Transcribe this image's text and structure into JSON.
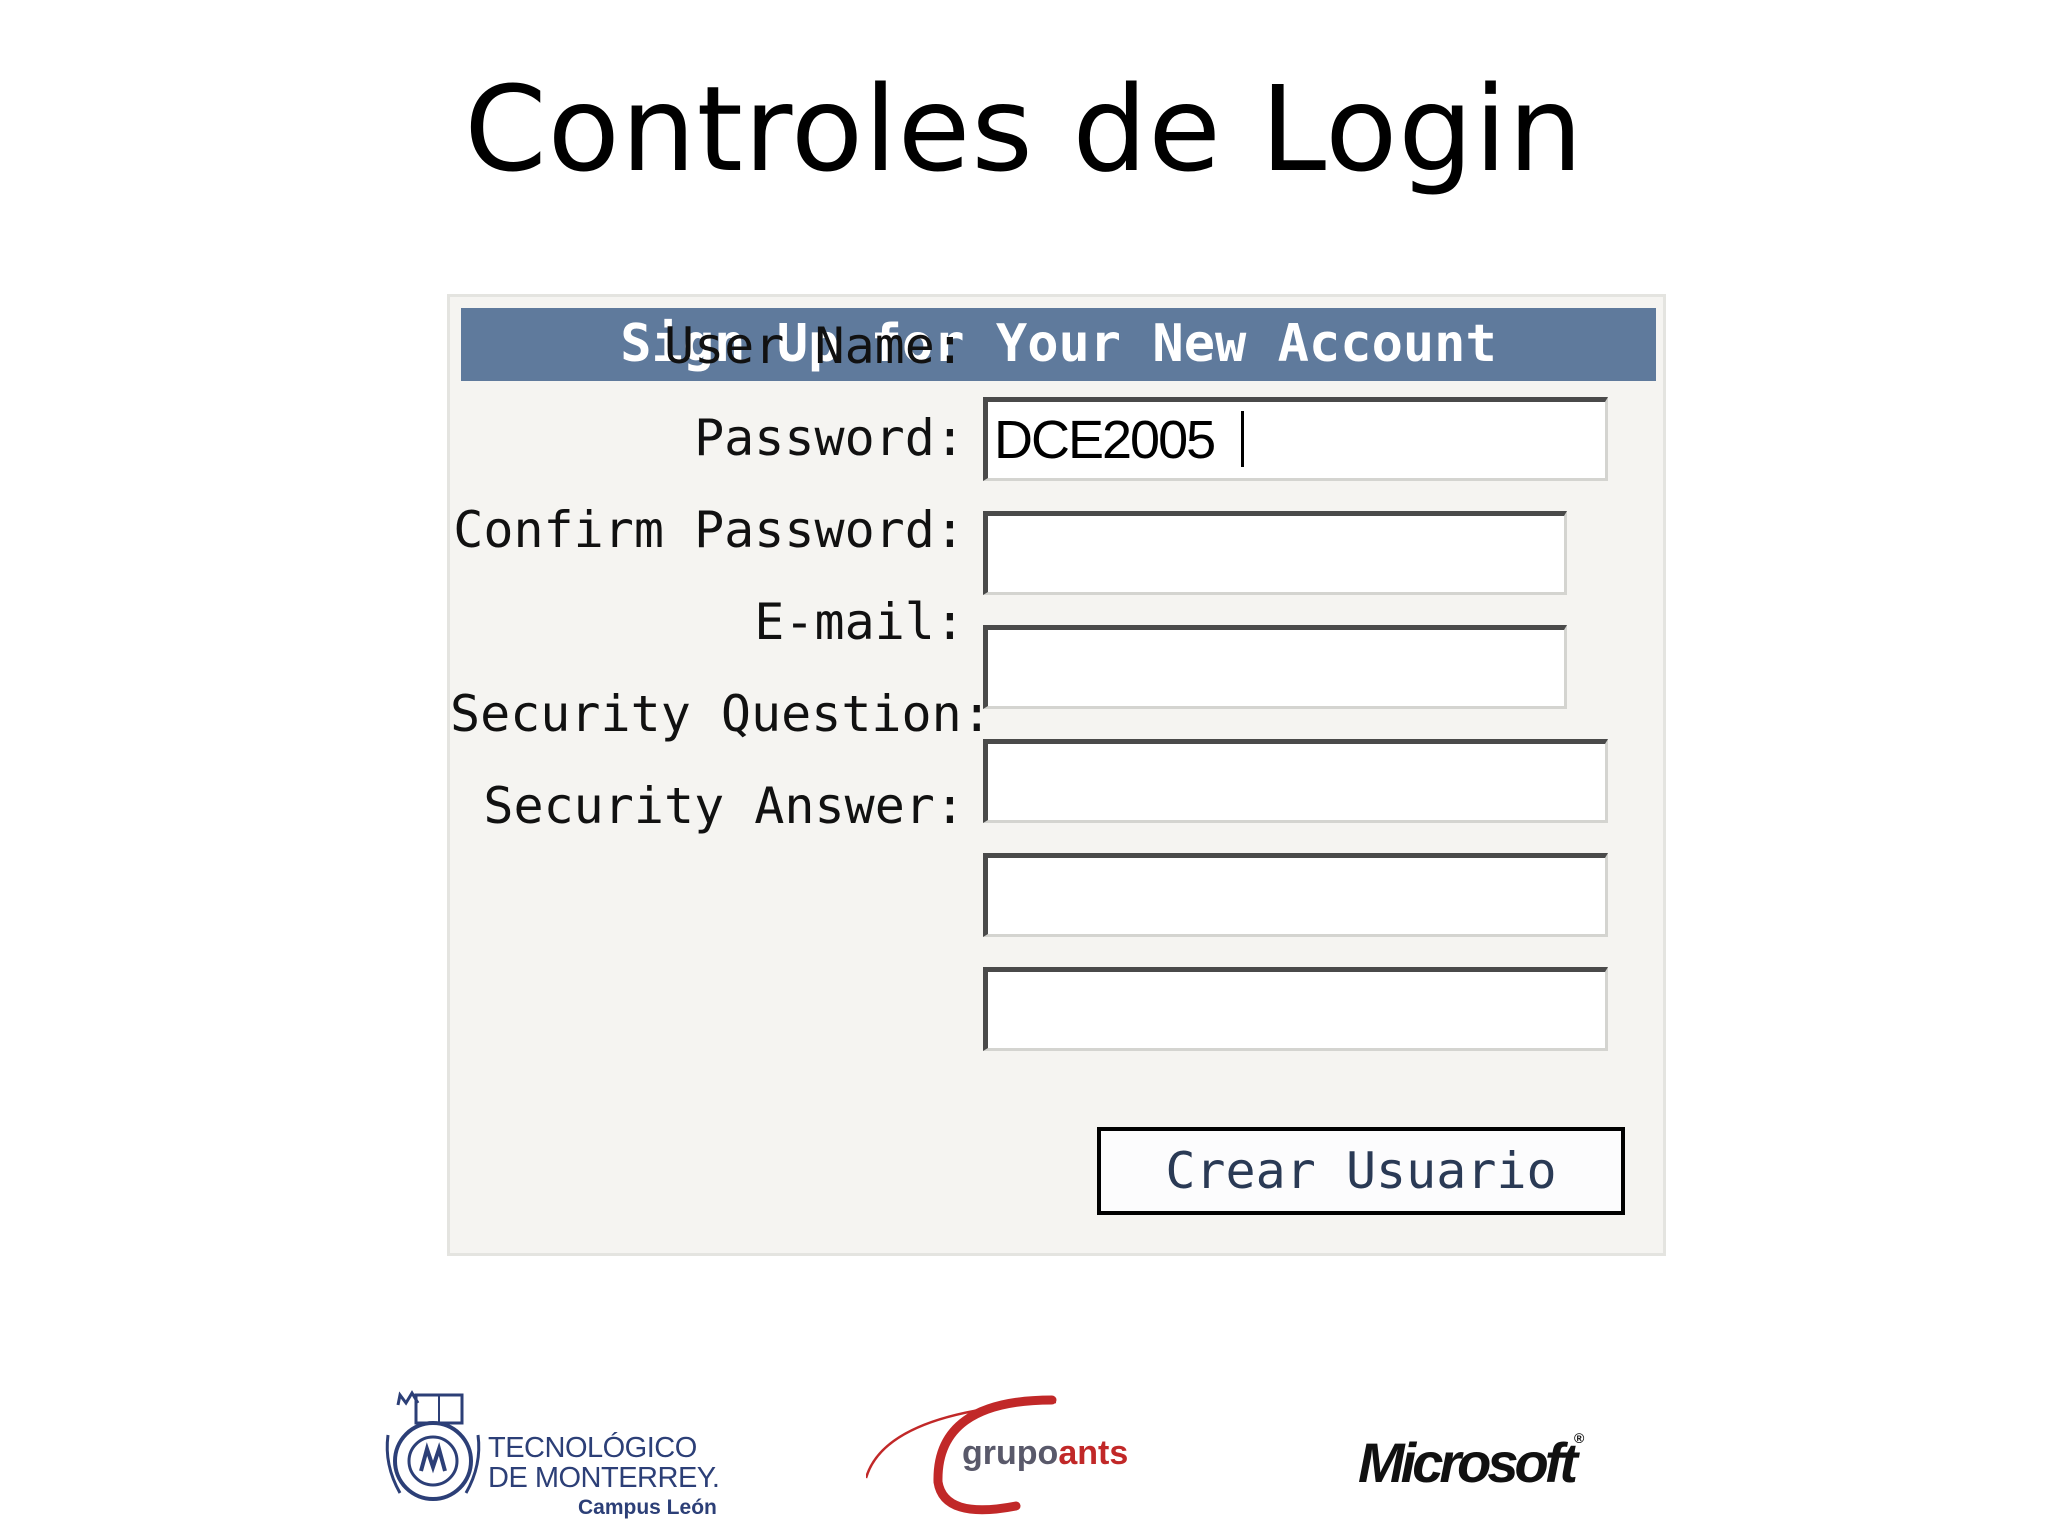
{
  "slide": {
    "title": "Controles de Login"
  },
  "signup_form": {
    "header": "Sign Up for Your New Account",
    "fields": [
      {
        "label": "User Name:",
        "value": "DCE2005",
        "placeholder": ""
      },
      {
        "label": "Password:",
        "value": "",
        "placeholder": ""
      },
      {
        "label": "Confirm Password:",
        "value": "",
        "placeholder": ""
      },
      {
        "label": "E-mail:",
        "value": "",
        "placeholder": ""
      },
      {
        "label": "Security Question:",
        "value": "",
        "placeholder": ""
      },
      {
        "label": "Security Answer:",
        "value": "",
        "placeholder": ""
      }
    ],
    "submit_label": "Crear Usuario"
  },
  "logos": {
    "tec": {
      "line1": "TECNOLÓGICO",
      "line2": "DE MONTERREY.",
      "line3": "Campus León"
    },
    "grupoants": {
      "part_a": "grupo",
      "part_b": "ants"
    },
    "microsoft": {
      "name": "Microsoft"
    }
  },
  "colors": {
    "header_bg": "#5f7a9c",
    "panel_bg": "#f5f4f1",
    "tec_blue": "#2c3f77",
    "grupoants_red": "#c12828"
  }
}
